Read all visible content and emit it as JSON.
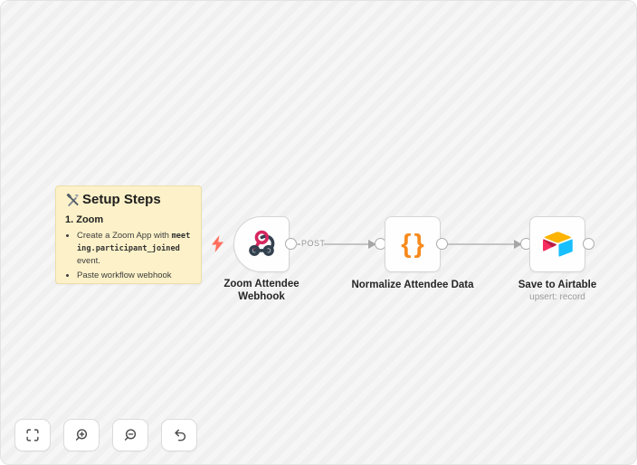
{
  "note": {
    "title": "Setup Steps",
    "heading": "1. Zoom",
    "bullet1_text": "Create a Zoom App with ",
    "bullet1_code": "meeting.participant_joined",
    "bullet1_suffix": " event.",
    "bullet2_text": "Paste workflow webhook"
  },
  "nodes": [
    {
      "label": "Zoom Attendee Webhook",
      "type": "webhook-trigger"
    },
    {
      "label": "Normalize Attendee Data",
      "icon_text": "{}",
      "type": "code"
    },
    {
      "label": "Save to Airtable",
      "subtitle": "upsert: record",
      "type": "airtable"
    }
  ],
  "connections": [
    {
      "label": "POST"
    },
    {
      "label": ""
    }
  ],
  "toolbar": {
    "buttons": [
      "fit-view",
      "zoom-in",
      "zoom-out",
      "undo"
    ]
  },
  "colors": {
    "trigger_bolt": "#FF6E5C",
    "webhook_pink": "#D6275F",
    "webhook_dark": "#33414F",
    "braces_orange": "#F78A1D",
    "airtable_yellow": "#FCB400",
    "airtable_blue": "#18BFFF",
    "airtable_pink": "#F82B60",
    "airtable_dark_pink": "#BA1E45",
    "note_bg": "#FCF1C8"
  }
}
